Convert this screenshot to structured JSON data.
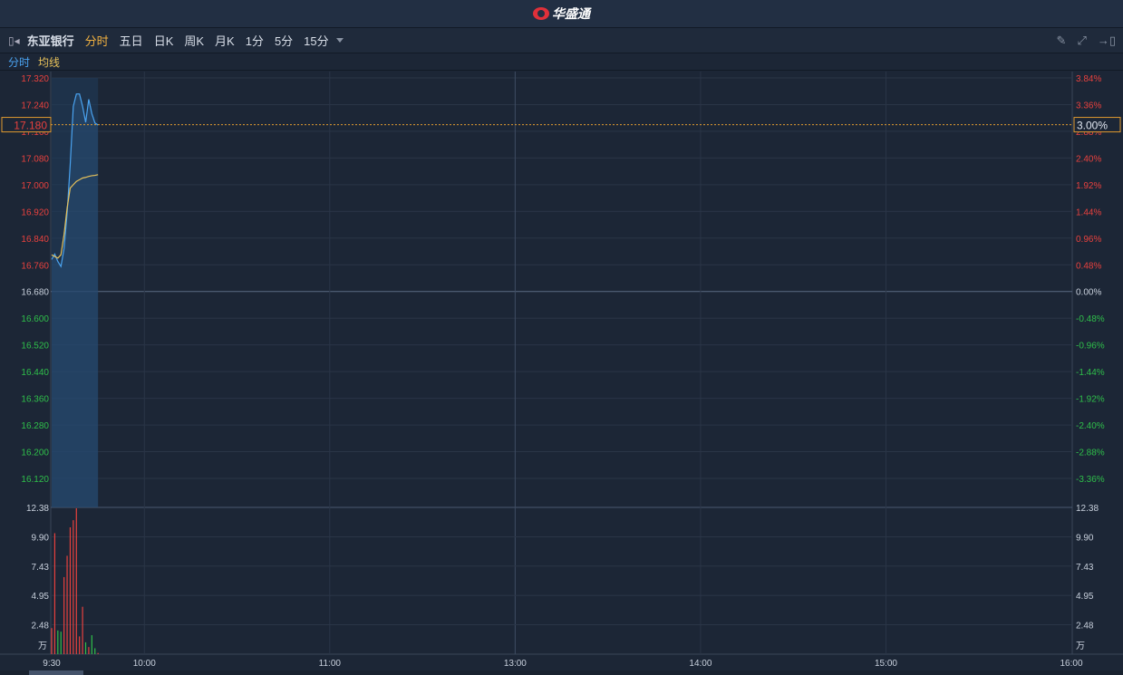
{
  "app": {
    "title": "华盛通"
  },
  "toolbar": {
    "stock_name": "东亚银行",
    "tabs": [
      "分时",
      "五日",
      "日K",
      "周K",
      "月K",
      "1分",
      "5分",
      "15分"
    ],
    "active_tab": "分时"
  },
  "legend": {
    "price": "分时",
    "avg": "均线"
  },
  "colors": {
    "up": "#e8413e",
    "down": "#2fbf4a",
    "price_line": "#4aa3f0",
    "avg_line": "#e8c25a",
    "accent": "#f0b040"
  },
  "current": {
    "price": "17.180",
    "pct": "3.00%"
  },
  "chart_data": {
    "type": "line",
    "base_price": 16.68,
    "price_ticks": [
      "17.320",
      "17.240",
      "17.160",
      "17.080",
      "17.000",
      "16.920",
      "16.840",
      "16.760",
      "16.680",
      "16.600",
      "16.520",
      "16.440",
      "16.360",
      "16.280",
      "16.200",
      "16.120"
    ],
    "pct_ticks": [
      "3.84%",
      "3.36%",
      "2.88%",
      "2.40%",
      "1.92%",
      "1.44%",
      "0.96%",
      "0.48%",
      "0.00%",
      "-0.48%",
      "-0.96%",
      "-1.44%",
      "-1.92%",
      "-2.40%",
      "-2.88%",
      "-3.36%"
    ],
    "ylim": [
      16.12,
      17.32
    ],
    "time_labels": [
      "9:30",
      "10:00",
      "11:00",
      "13:00",
      "14:00",
      "15:00",
      "16:00"
    ],
    "price_series": [
      16.776,
      16.792,
      16.77,
      16.755,
      16.808,
      16.915,
      17.06,
      17.235,
      17.272,
      17.272,
      17.235,
      17.187,
      17.256,
      17.213,
      17.185,
      17.179
    ],
    "avg_series": [
      16.79,
      16.785,
      16.78,
      16.79,
      16.85,
      16.93,
      16.99,
      17.0,
      17.01,
      17.015,
      17.02,
      17.022,
      17.025,
      17.027,
      17.028,
      17.03
    ],
    "volume_ticks": [
      "12.38",
      "9.90",
      "7.43",
      "4.95",
      "2.48"
    ],
    "volume_unit": "万",
    "volume_max": 12.38,
    "volume": [
      {
        "v": 2.2,
        "d": "up"
      },
      {
        "v": 10.2,
        "d": "up"
      },
      {
        "v": 2.0,
        "d": "down"
      },
      {
        "v": 1.9,
        "d": "down"
      },
      {
        "v": 6.5,
        "d": "up"
      },
      {
        "v": 8.3,
        "d": "up"
      },
      {
        "v": 10.7,
        "d": "up"
      },
      {
        "v": 11.3,
        "d": "up"
      },
      {
        "v": 12.3,
        "d": "up"
      },
      {
        "v": 1.5,
        "d": "up"
      },
      {
        "v": 4.0,
        "d": "up"
      },
      {
        "v": 1.0,
        "d": "down"
      },
      {
        "v": 0.6,
        "d": "up"
      },
      {
        "v": 1.6,
        "d": "down"
      },
      {
        "v": 0.5,
        "d": "down"
      },
      {
        "v": 0.1,
        "d": "up"
      }
    ]
  }
}
